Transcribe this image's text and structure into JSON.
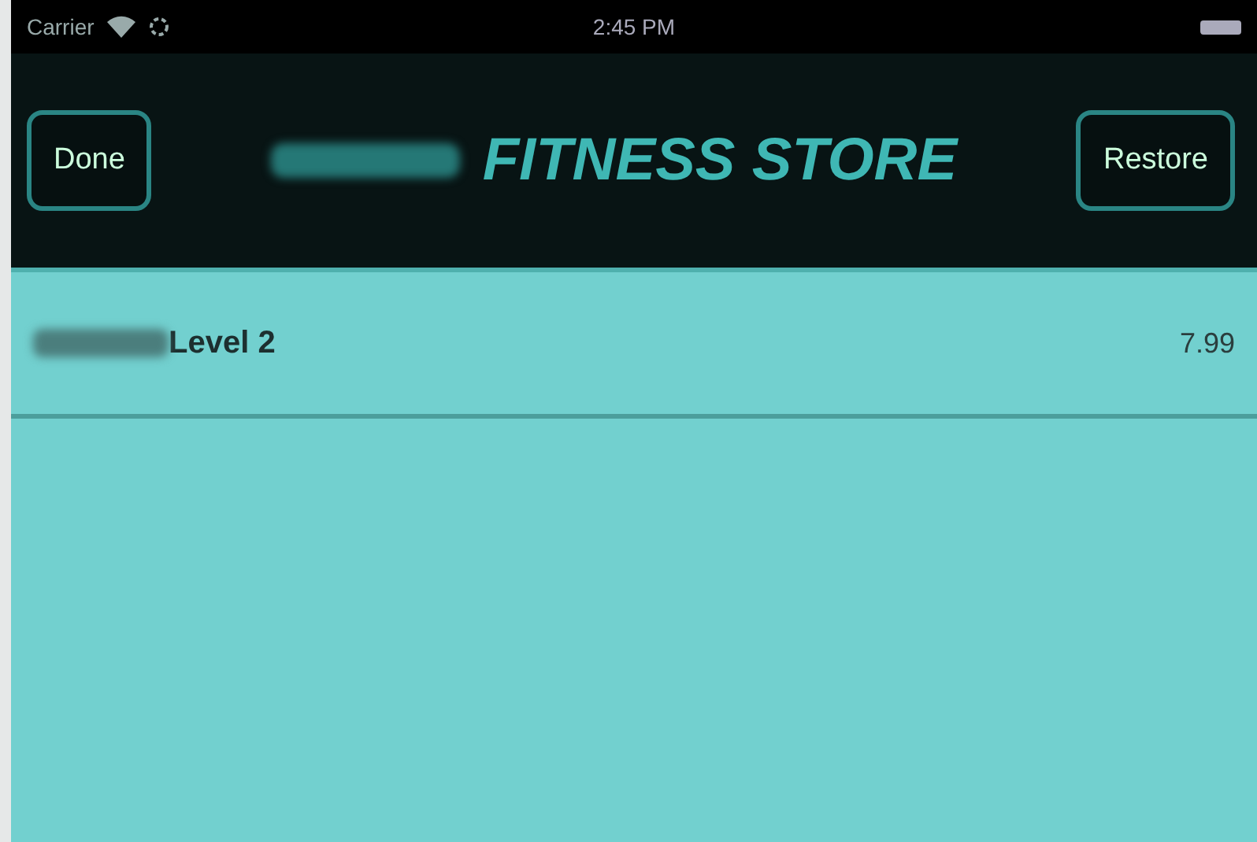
{
  "status_bar": {
    "carrier": "Carrier",
    "time": "2:45 PM"
  },
  "nav_bar": {
    "left_button": "Done",
    "title": "FITNESS STORE",
    "right_button": "Restore"
  },
  "products": [
    {
      "name": "Level 2",
      "price": "7.99"
    }
  ]
}
